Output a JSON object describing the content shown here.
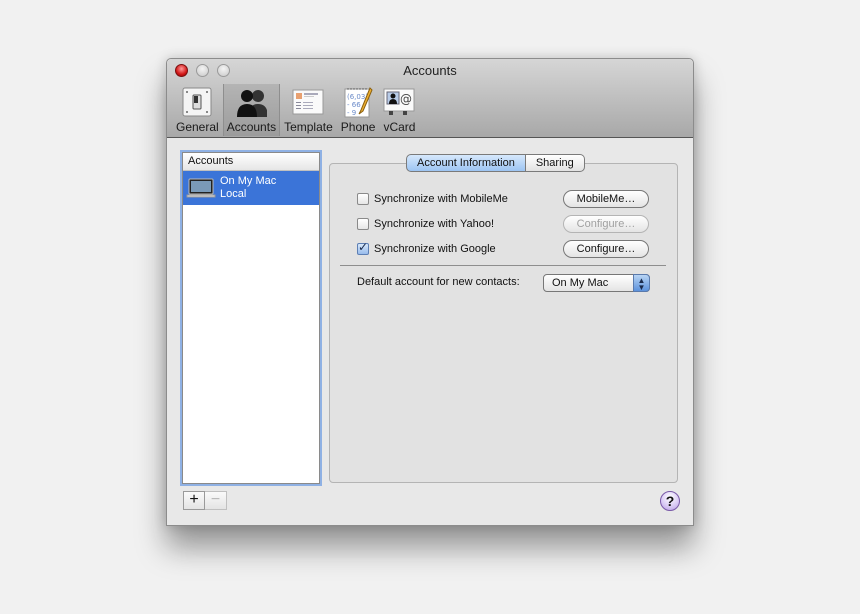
{
  "window": {
    "title": "Accounts",
    "traffic_lights": [
      "close",
      "minimize",
      "zoom"
    ]
  },
  "toolbar": {
    "items": [
      {
        "label": "General",
        "icon": "switch-icon",
        "selected": false
      },
      {
        "label": "Accounts",
        "icon": "people-icon",
        "selected": true
      },
      {
        "label": "Template",
        "icon": "card-template-icon",
        "selected": false
      },
      {
        "label": "Phone",
        "icon": "notepad-pencil-icon",
        "selected": false
      },
      {
        "label": "vCard",
        "icon": "vcard-icon",
        "selected": false
      }
    ]
  },
  "accounts_list": {
    "header": "Accounts",
    "items": [
      {
        "name": "On My Mac",
        "subtitle": "Local",
        "icon": "laptop-icon",
        "selected": true
      }
    ],
    "add_label": "+",
    "remove_label": "−"
  },
  "tabs": {
    "items": [
      "Account Information",
      "Sharing"
    ],
    "selected": "Account Information"
  },
  "sync": [
    {
      "label": "Synchronize with MobileMe",
      "checked": false,
      "button": "MobileMe…",
      "button_enabled": true
    },
    {
      "label": "Synchronize with Yahoo!",
      "checked": false,
      "button": "Configure…",
      "button_enabled": false
    },
    {
      "label": "Synchronize with Google",
      "checked": true,
      "button": "Configure…",
      "button_enabled": true
    }
  ],
  "default_account": {
    "label": "Default account for new contacts:",
    "value": "On My Mac"
  },
  "help": {
    "label": "?"
  },
  "colors": {
    "selection": "#3b74d8",
    "focus_ring": "#8fb1e4",
    "help_purple": "#b49ae0"
  }
}
